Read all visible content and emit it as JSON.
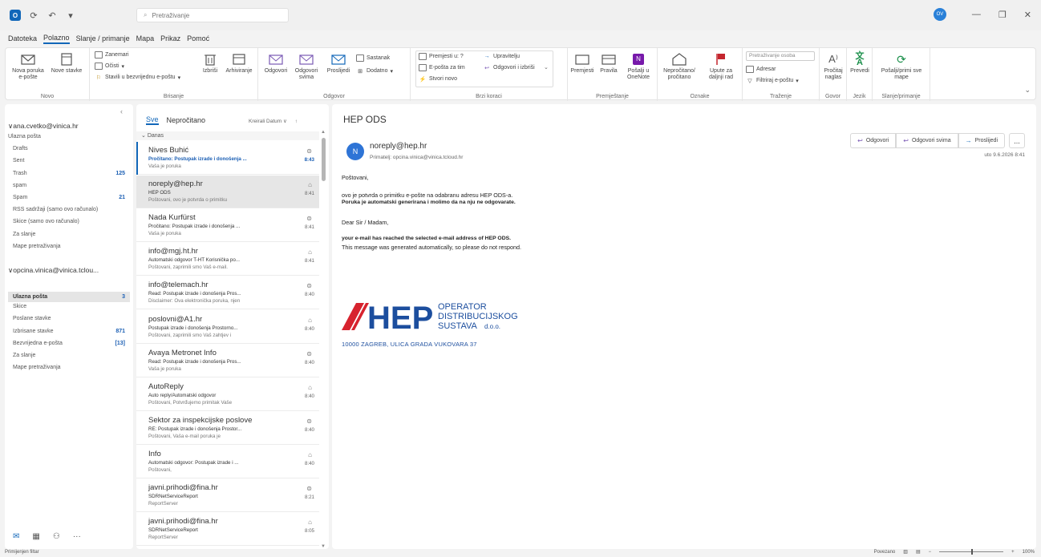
{
  "titlebar": {
    "search_placeholder": "Pretraživanje",
    "avatar_initials": "OV"
  },
  "menu_tabs": [
    "Datoteka",
    "Polazno",
    "Slanje / primanje",
    "Mapa",
    "Prikaz",
    "Pomoć"
  ],
  "ribbon": {
    "novo": {
      "label": "Novo",
      "new_mail": "Nova poruka e-pošte",
      "new_items": "Nove stavke"
    },
    "brisanje": {
      "label": "Brisanje",
      "ignore": "Zanemari",
      "clean": "Očisti",
      "block": "Stavili u bezvrijednu e-poštu",
      "delete": "Izbriši",
      "archive": "Arhiviranje"
    },
    "odgovor": {
      "label": "Odgovor",
      "reply": "Odgovori",
      "reply_all": "Odgovori svima",
      "forward": "Proslijedi",
      "meeting": "Sastanak",
      "more": "Dodatno"
    },
    "brzi_koraci": {
      "label": "Brzi koraci",
      "move_to": "Premjesti u: ?",
      "email_team": "E-pošta za tim",
      "create_new": "Stvori novo",
      "manager": "Upravitelju",
      "reply_delete": "Odgovori i izbriši"
    },
    "premjestanje": {
      "label": "Premještanje",
      "move": "Premjesti",
      "rules": "Pravila",
      "onenote": "Pošalji u OneNote"
    },
    "oznake": {
      "label": "Oznake",
      "unread": "Nepročitano/ pročitano",
      "followup": "Upute za daljnji rad"
    },
    "trazenje": {
      "label": "Traženje",
      "people_search": "Pretraživanje osoba",
      "address_book": "Adresar",
      "filter": "Filtriraj e-poštu"
    },
    "govor": {
      "label": "Govor",
      "read_aloud": "Pročitaj naglas"
    },
    "jezik": {
      "label": "Jezik",
      "translate": "Prevedi"
    },
    "slanje": {
      "label": "Slanje/primanje",
      "send_receive": "Pošalji/primi sve mape"
    }
  },
  "folders": {
    "account1": "ana.cvetko@vinica.hr",
    "account1_items": [
      {
        "name": "Ulazna pošta",
        "count": ""
      },
      {
        "name": "Drafts",
        "count": ""
      },
      {
        "name": "Sent",
        "count": ""
      },
      {
        "name": "Trash",
        "count": "125"
      },
      {
        "name": "spam",
        "count": ""
      },
      {
        "name": "Spam",
        "count": "21"
      },
      {
        "name": "RSS sadržaji (samo ovo računalo)",
        "count": ""
      },
      {
        "name": "Skice (samo ovo računalo)",
        "count": ""
      },
      {
        "name": "Za slanje",
        "count": ""
      },
      {
        "name": "Mape pretraživanja",
        "count": ""
      }
    ],
    "account2": "opcina.vinica@vinica.tclou...",
    "account2_items": [
      {
        "name": "Ulazna pošta",
        "count": "3"
      },
      {
        "name": "Skice",
        "count": ""
      },
      {
        "name": "Poslane stavke",
        "count": ""
      },
      {
        "name": "Izbrisane stavke",
        "count": "871"
      },
      {
        "name": "Bezvrijedna e-pošta",
        "count": "[13]"
      },
      {
        "name": "Za slanje",
        "count": ""
      },
      {
        "name": "Mape pretraživanja",
        "count": ""
      }
    ]
  },
  "list": {
    "tab_all": "Sve",
    "tab_unread": "Nepročitano",
    "sort": "Kreirali Datum",
    "group": "Danas",
    "messages": [
      {
        "from": "Nives Buhić",
        "subject": "Pročitano: Postupak izrade i donošenja ...",
        "preview": "Vaša je poruka",
        "time": "8:43",
        "unread": true
      },
      {
        "from": "noreply@hep.hr",
        "subject": "HEP ODS",
        "preview": "Poštovani, ovo je potvrda o primitku",
        "time": "8:41",
        "unread": false,
        "selected": true
      },
      {
        "from": "Nada Kurfürst",
        "subject": "Pročitano: Postupak izrade i donošenja ...",
        "preview": "Vaša je poruka",
        "time": "8:41",
        "unread": false
      },
      {
        "from": "info@mgj.ht.hr",
        "subject": "Automatski odgovor T-HT Korisnička po...",
        "preview": "Poštovani, zaprimili smo Vaš e-mail.",
        "time": "8:41",
        "unread": false
      },
      {
        "from": "info@telemach.hr",
        "subject": "Read: Postupak izrade i donošenja Pros...",
        "preview": "Disclaimer: Ova elektronička poruka, njen",
        "time": "8:40",
        "unread": false
      },
      {
        "from": "poslovni@A1.hr",
        "subject": "Postupak izrade i donošenja Prostorno...",
        "preview": "Poštovani, zaprimili smo Vaš zahtjev i",
        "time": "8:40",
        "unread": false
      },
      {
        "from": "Avaya Metronet Info",
        "subject": "Read: Postupak izrade i donošenja Pros...",
        "preview": "Vaša je poruka",
        "time": "8:40",
        "unread": false
      },
      {
        "from": "AutoReply",
        "subject": "Auto reply/Automatski odgovor",
        "preview": "Poštovani, Potvrđujemo primitak Vaše",
        "time": "8:40",
        "unread": false
      },
      {
        "from": "Sektor za inspekcijske poslove",
        "subject": "RE: Postupak izrade i donošenja Prostor...",
        "preview": "Poštovani, Vaša e-mail poruka je",
        "time": "8:40",
        "unread": false
      },
      {
        "from": "Info",
        "subject": "Automatski odgovor: Postupak izrade i ...",
        "preview": "Poštovani,",
        "time": "8:40",
        "unread": false
      },
      {
        "from": "javni.prihodi@fina.hr",
        "subject": "SDRNetServiceReport",
        "preview": "ReportServer",
        "time": "8:21",
        "unread": false
      },
      {
        "from": "javni.prihodi@fina.hr",
        "subject": "SDRNetServiceReport",
        "preview": "ReportServer",
        "time": "8:05",
        "unread": false
      }
    ]
  },
  "reading": {
    "subject": "HEP ODS",
    "avatar": "N",
    "from": "noreply@hep.hr",
    "to": "Primatelj:  opcina.vinica@vinica.tcloud.hr",
    "reply": "Odgovori",
    "reply_all": "Odgovori svima",
    "forward": "Proslijedi",
    "more": "...",
    "date": "uto 9.6.2026 8:41",
    "greeting_hr": "Poštovani,",
    "line1_hr": "ovo je potvrda o primitku e-pošte na odabranu adresu HEP ODS-a.",
    "line2_hr": "Poruka je automatski generirana i molimo da na nju ne odgovarate.",
    "greeting_en": "Dear Sir / Madam,",
    "line1_en": "your e-mail has reached the selected e-mail address of HEP ODS.",
    "line2_en": "This message was generated automatically, so please do not respond.",
    "logo_word": "HEP",
    "logo_line1": "OPERATOR",
    "logo_line2": "DISTRIBUCIJSKOG",
    "logo_line3": "SUSTAVA",
    "logo_suffix": "d.o.o.",
    "address": "10000 ZAGREB, ULICA GRADA VUKOVARA 37"
  },
  "status": {
    "filter": "Primijenjen filtar",
    "connected": "Povezano",
    "zoom": "100%"
  },
  "colors": {
    "accent": "#1267b9",
    "hep_red": "#d7232e",
    "hep_blue": "#1c4e9e"
  }
}
